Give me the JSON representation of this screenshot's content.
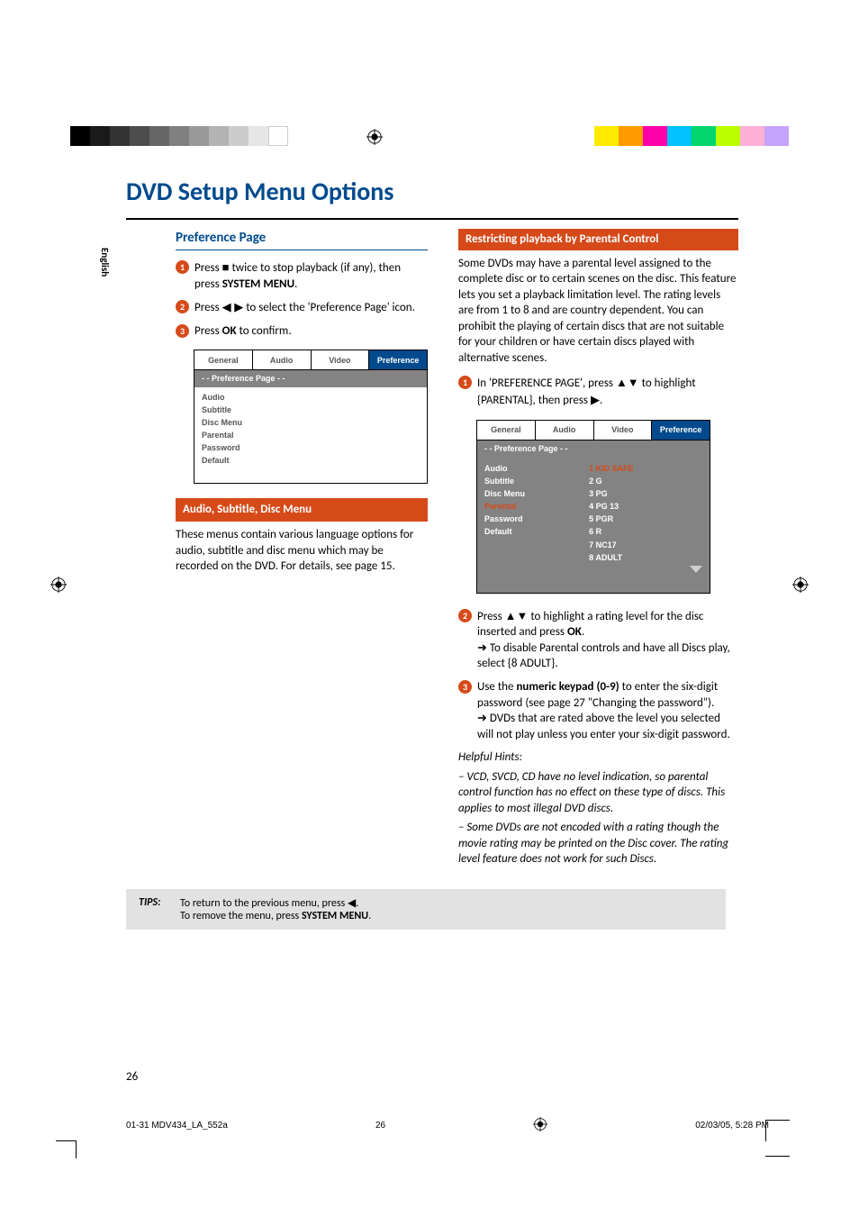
{
  "tab_label": "English",
  "page_title": "DVD Setup Menu Options",
  "left": {
    "section_title": "Preference Page",
    "step1_a": "Press ",
    "step1_b": " twice to stop playback (if any), then press ",
    "step1_c": "SYSTEM MENU",
    "step1_d": ".",
    "step2_a": "Press ",
    "step2_b": " to select the 'Preference Page' icon.",
    "step3_a": "Press ",
    "step3_b": "OK",
    "step3_c": " to confirm.",
    "osd1": {
      "tabs": [
        "General",
        "Audio",
        "Video",
        "Preference"
      ],
      "header": "- -   Preference Page   - -",
      "items": [
        "Audio",
        "Subtitle",
        "Disc Menu",
        "Parental",
        "Password",
        "Default"
      ]
    },
    "topic1_title": "Audio, Subtitle, Disc Menu",
    "topic1_body": "These menus contain various language options for audio, subtitle and disc menu which may be recorded on the DVD.  For details, see page 15."
  },
  "right": {
    "topic2_title": "Restricting playback by Parental Control",
    "intro": "Some DVDs may have a parental level assigned to the complete disc or to certain scenes on the disc.  This feature lets you set a playback limitation level.  The rating levels are from 1 to 8 and are country dependent.  You can prohibit the playing of certain discs that are not suitable for your children or have certain discs played with alternative scenes.",
    "step1_a": "In 'PREFERENCE PAGE', press ",
    "step1_b": " to highlight {PARENTAL}, then press ",
    "step1_c": ".",
    "osd2": {
      "tabs": [
        "General",
        "Audio",
        "Video",
        "Preference"
      ],
      "header": "- -   Preference Page   - -",
      "left_items": [
        "Audio",
        "Subtitle",
        "Disc Menu",
        "Parental",
        "Password",
        "Default"
      ],
      "right_items": [
        "1 KID SAFE",
        "2 G",
        "3 PG",
        "4 PG 13",
        "5 PGR",
        "6 R",
        "7 NC17",
        "8 ADULT"
      ]
    },
    "step2_a": "Press ",
    "step2_b": " to highlight a rating level for the disc inserted and press ",
    "step2_c": "OK",
    "step2_d": ".",
    "step2_sub": "To disable Parental controls and have all Discs play, select {8 ADULT}.",
    "step3_a": "Use the ",
    "step3_b": "numeric keypad (0-9)",
    "step3_c": " to enter the six-digit password (see page 27 \"Changing the password\").",
    "step3_sub": "DVDs that are rated above the level you selected will not play unless you enter your six-digit password.",
    "hints_label": "Helpful Hints:",
    "hint1": "–    VCD, SVCD, CD have no level indication, so parental control function has no effect on these type of discs. This applies to most illegal DVD discs.",
    "hint2": "–    Some DVDs are not encoded with a rating though the movie rating may be printed on the Disc cover.  The rating level feature does not work for such Discs."
  },
  "tips": {
    "label": "TIPS:",
    "line1_a": "To return to the previous menu, press ",
    "line1_b": ".",
    "line2_a": "To remove the menu, press ",
    "line2_b": "SYSTEM MENU",
    "line2_c": "."
  },
  "page_number": "26",
  "footer": {
    "file": "01-31 MDV434_LA_552a",
    "folio": "26",
    "timestamp": "02/03/05, 5:28 PM"
  },
  "colors": {
    "accent": "#004a8d",
    "orange": "#d64a1a"
  }
}
